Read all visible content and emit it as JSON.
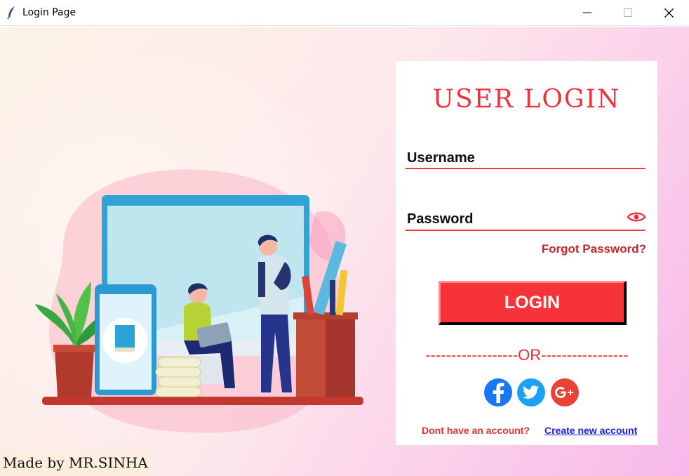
{
  "window": {
    "title": "Login Page",
    "icon": "feather-icon",
    "controls": [
      "minimize-icon",
      "maximize-icon",
      "close-icon"
    ]
  },
  "card": {
    "title": "USER LOGIN",
    "username_label": "Username",
    "password_label": "Password",
    "forgot_label": "Forgot Password?",
    "login_label": "LOGIN",
    "or_text": "------------------OR-----------------",
    "social": [
      "facebook-icon",
      "twitter-icon",
      "google-plus-icon"
    ],
    "signup_prompt": "Dont have an account?",
    "signup_link": "Create new account"
  },
  "footer": {
    "credit": "Made by MR.SINHA"
  },
  "colors": {
    "accent": "#f0323c",
    "link": "#1d1ddb",
    "facebook": "#1877f2",
    "twitter": "#1da1f2",
    "google": "#ea4335"
  }
}
